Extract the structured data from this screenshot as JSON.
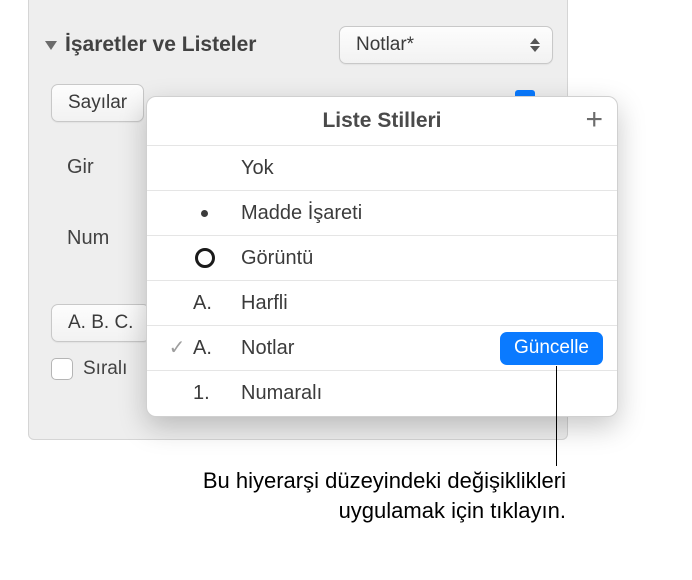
{
  "section": {
    "title": "İşaretler ve Listeler",
    "dropdown_label": "Notlar*"
  },
  "subrow": {
    "button_label": "Sayılar"
  },
  "labels": {
    "gir_prefix": "Gir",
    "num_prefix": "Num"
  },
  "abc": {
    "button_label": "A. B. C."
  },
  "checkbox": {
    "label": "Sıralı"
  },
  "popover": {
    "title": "Liste Stilleri",
    "items": [
      {
        "icon": "",
        "label": "Yok"
      },
      {
        "icon": "•",
        "label": "Madde İşareti"
      },
      {
        "icon": "○",
        "label": "Görüntü"
      },
      {
        "icon": "A.",
        "label": "Harfli"
      },
      {
        "icon": "A.",
        "label": "Notlar"
      },
      {
        "icon": "1.",
        "label": "Numaralı"
      }
    ],
    "update_label": "Güncelle"
  },
  "callout": {
    "text": "Bu hiyerarşi düzeyindeki değişiklikleri uygulamak için tıklayın."
  }
}
